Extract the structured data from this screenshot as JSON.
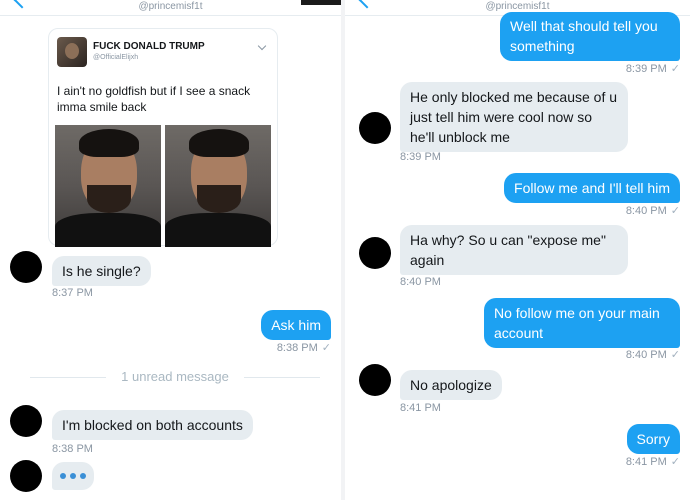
{
  "left": {
    "header": {
      "handle": "@princemisf1t"
    },
    "tweet": {
      "name": "FUCK DONALD TRUMP",
      "handle": "@OfficialElijxh",
      "text": "I ain't no goldfish but if I see a snack imma smile back"
    },
    "messages": [
      {
        "text": "Is he single?",
        "time": "8:37 PM"
      },
      {
        "text": "Ask him",
        "time": "8:38 PM",
        "check": "✓"
      },
      {
        "text": "I'm blocked on both accounts",
        "time": "8:38 PM"
      }
    ],
    "unread": "1 unread message",
    "typing_icon": "typing-dots-icon"
  },
  "right": {
    "header": {
      "handle": "@princemisf1t"
    },
    "messages": [
      {
        "text": "Well that should tell you something",
        "time": "8:39 PM",
        "check": "✓"
      },
      {
        "text": "He only blocked me because of u just tell him were cool now so he'll unblock me",
        "time": "8:39 PM"
      },
      {
        "text": "Follow me and I'll tell him",
        "time": "8:40 PM",
        "check": "✓"
      },
      {
        "text": "Ha why? So u can \"expose me\" again",
        "time": "8:40 PM"
      },
      {
        "text": "No follow me on your main account",
        "time": "8:40 PM",
        "check": "✓"
      },
      {
        "text": "No apologize",
        "time": "8:41 PM"
      },
      {
        "text": "Sorry",
        "time": "8:41 PM",
        "check": "✓"
      }
    ]
  },
  "colors": {
    "outgoing": "#1da1f2",
    "incoming": "#e6ecf0",
    "meta": "#8a96a3"
  }
}
